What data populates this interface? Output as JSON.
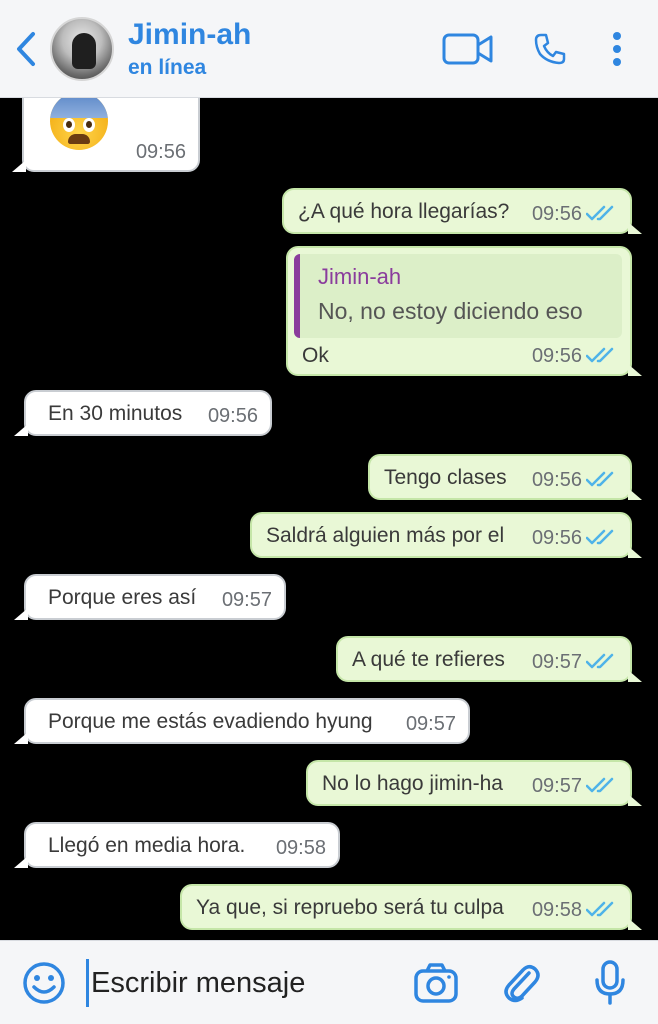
{
  "header": {
    "contact_name": "Jimin-ah",
    "contact_status": "en línea",
    "icons": [
      "chevron-left-icon",
      "video-camera-icon",
      "phone-icon",
      "more-vert-icon"
    ],
    "accent_color": "#2f86e0"
  },
  "messages": [
    {
      "direction": "in",
      "type": "emoji",
      "emoji": "anxious-face",
      "time": "09:56"
    },
    {
      "direction": "out",
      "text": "¿A qué hora llegarías?",
      "time": "09:56",
      "read": true
    },
    {
      "direction": "out",
      "type": "reply",
      "quote_author": "Jimin-ah",
      "quote_text": "No, no estoy diciendo eso",
      "text": "Ok",
      "time": "09:56",
      "read": true
    },
    {
      "direction": "in",
      "text": "En 30 minutos",
      "time": "09:56"
    },
    {
      "direction": "out",
      "text": "Tengo clases",
      "time": "09:56",
      "read": true
    },
    {
      "direction": "out",
      "text": "Saldrá alguien más por el",
      "time": "09:56",
      "read": true
    },
    {
      "direction": "in",
      "text": "Porque eres así",
      "time": "09:57"
    },
    {
      "direction": "out",
      "text": "A qué te refieres",
      "time": "09:57",
      "read": true
    },
    {
      "direction": "in",
      "text": "Porque me estás evadiendo hyung",
      "time": "09:57"
    },
    {
      "direction": "out",
      "text": "No lo hago jimin-ha",
      "time": "09:57",
      "read": true
    },
    {
      "direction": "in",
      "text": "Llegó en media hora.",
      "time": "09:58"
    },
    {
      "direction": "out",
      "text": "Ya que, si repruebo será tu culpa",
      "time": "09:58",
      "read": true
    }
  ],
  "input": {
    "placeholder": "Escribir mensaje",
    "icons": [
      "emoji-icon",
      "camera-icon",
      "attach-icon",
      "microphone-icon"
    ]
  },
  "colors": {
    "outgoing_bubble": "#e9f8d6",
    "incoming_bubble": "#ffffff",
    "read_ticks": "#4fb3e8",
    "quote_accent": "#8a3c9c"
  }
}
